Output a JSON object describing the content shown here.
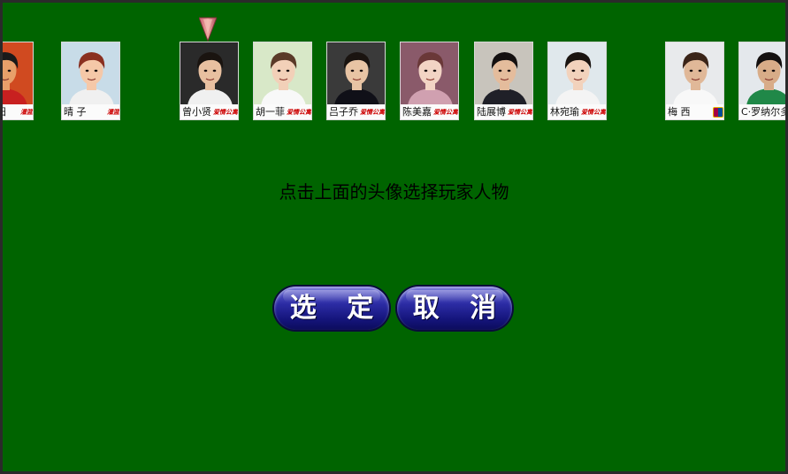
{
  "prompt": "点击上面的头像选择玩家人物",
  "buttons": {
    "confirm": "选 定",
    "cancel": "取 消"
  },
  "avatars": [
    {
      "name": "城良田",
      "logo": "灌篮",
      "skin": "#e8a06a",
      "hair": "#1a1a1a",
      "bg": "#d04a20",
      "cloth": "#c82020"
    },
    {
      "name": "晴 子",
      "logo": "灌篮",
      "skin": "#f5c8a8",
      "hair": "#8a3020",
      "bg": "#c8dce8",
      "cloth": "#f0f0f0"
    },
    {
      "name": "曾小贤",
      "logo": "爱情公寓",
      "skin": "#e8c0a0",
      "hair": "#1a1410",
      "bg": "#2a2a2a",
      "cloth": "#f0f0f0"
    },
    {
      "name": "胡一菲",
      "logo": "爱情公寓",
      "skin": "#f2d0b8",
      "hair": "#5a3a28",
      "bg": "#d8e8c8",
      "cloth": "#f8f8f8"
    },
    {
      "name": "吕子乔",
      "logo": "爱情公寓",
      "skin": "#e8c4a4",
      "hair": "#1a1410",
      "bg": "#3a3a3a",
      "cloth": "#101018"
    },
    {
      "name": "陈美嘉",
      "logo": "爱情公寓",
      "skin": "#f2d4c4",
      "hair": "#6a3838",
      "bg": "#8a5a6a",
      "cloth": "#d0a0b0"
    },
    {
      "name": "陆展博",
      "logo": "爱情公寓",
      "skin": "#e4bc9c",
      "hair": "#141010",
      "bg": "#c8c4bc",
      "cloth": "#202028"
    },
    {
      "name": "林宛瑜",
      "logo": "爱情公寓",
      "skin": "#f2d2bc",
      "hair": "#1a1410",
      "bg": "#e0e8ec",
      "cloth": "#f4f4f4"
    },
    {
      "name": "梅 西",
      "logo": "",
      "skin": "#e0b898",
      "hair": "#3a2418",
      "bg": "#e8eaec",
      "cloth": "#f8f8f8"
    },
    {
      "name": "C·罗纳尔多",
      "logo": "",
      "skin": "#d8ac88",
      "hair": "#141010",
      "bg": "#e4e8ec",
      "cloth": "#208848"
    }
  ]
}
